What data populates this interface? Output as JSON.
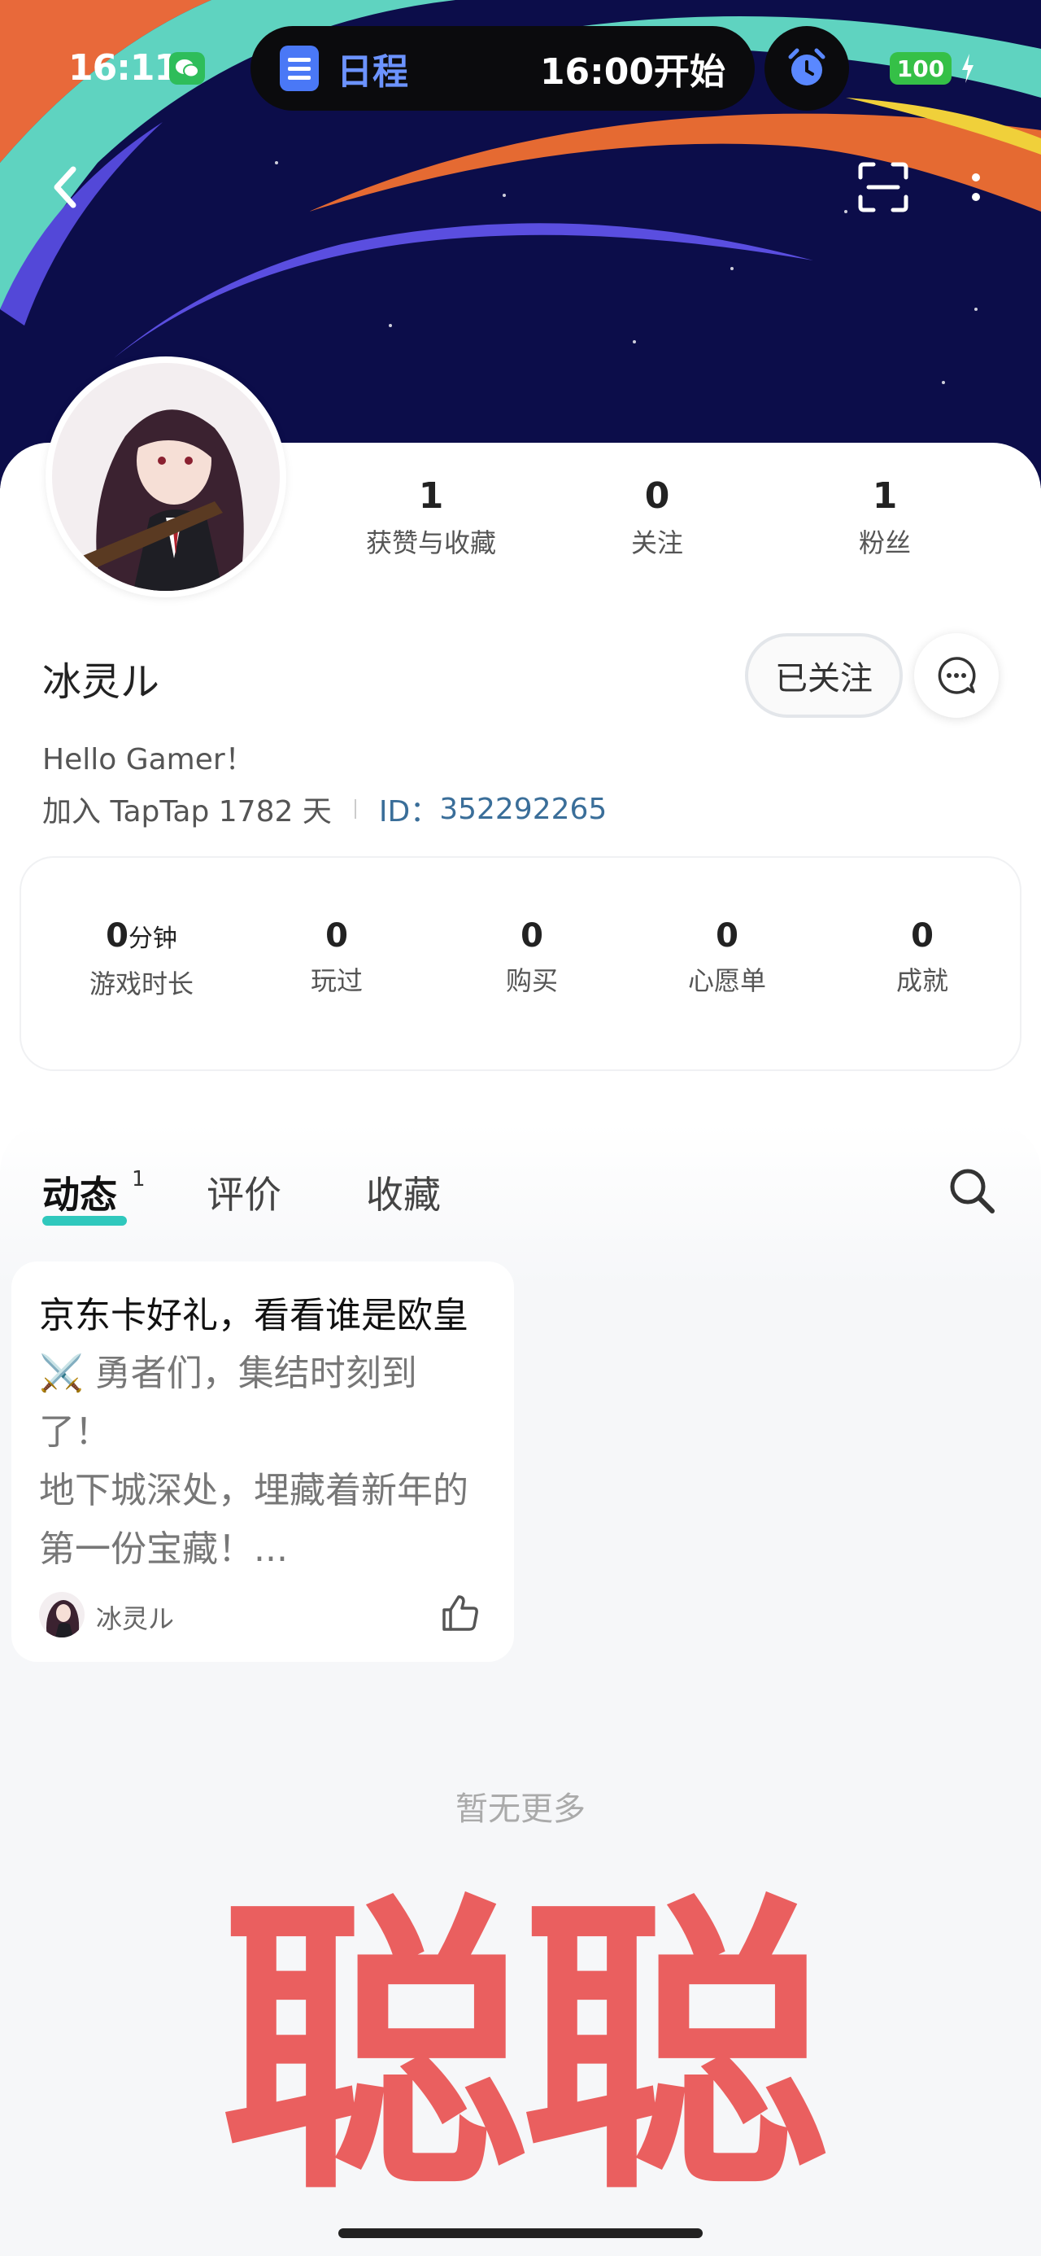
{
  "status_bar": {
    "time": "16:11",
    "island_app": "日程",
    "island_time": "16:00开始",
    "battery": "100"
  },
  "profile": {
    "stats": [
      {
        "value": "1",
        "label": "获赞与收藏"
      },
      {
        "value": "0",
        "label": "关注"
      },
      {
        "value": "1",
        "label": "粉丝"
      }
    ],
    "username": "冰灵ル",
    "follow_label": "已关注",
    "bio": "Hello Gamer！",
    "joined": "加入 TapTap 1782 天",
    "id_label": "ID：",
    "id_value": "352292265"
  },
  "game_stats": [
    {
      "value": "0",
      "unit": "分钟",
      "label": "游戏时长"
    },
    {
      "value": "0",
      "unit": "",
      "label": "玩过"
    },
    {
      "value": "0",
      "unit": "",
      "label": "购买"
    },
    {
      "value": "0",
      "unit": "",
      "label": "心愿单"
    },
    {
      "value": "0",
      "unit": "",
      "label": "成就"
    }
  ],
  "tabs": [
    {
      "label": "动态",
      "badge": "1",
      "active": true
    },
    {
      "label": "评价"
    },
    {
      "label": "收藏"
    }
  ],
  "post": {
    "title": "京东卡好礼，看看谁是欧皇",
    "body_lines": [
      "⚔️ 勇者们，集结时刻到",
      "了！",
      "地下城深处，埋藏着新年的",
      "第一份宝藏！..."
    ],
    "author": "冰灵ル"
  },
  "feed_end_text": "暂无更多",
  "watermark": "聪聪",
  "colors": {
    "accent_teal": "#30c8bd",
    "id_blue": "#3a6e99",
    "watermark_red": "#ea5f5f"
  },
  "icons": [
    "wechat-icon",
    "calendar-icon",
    "alarm-icon",
    "charging-icon",
    "back-icon",
    "scan-icon",
    "more-icon",
    "message-icon",
    "search-icon",
    "like-icon"
  ]
}
